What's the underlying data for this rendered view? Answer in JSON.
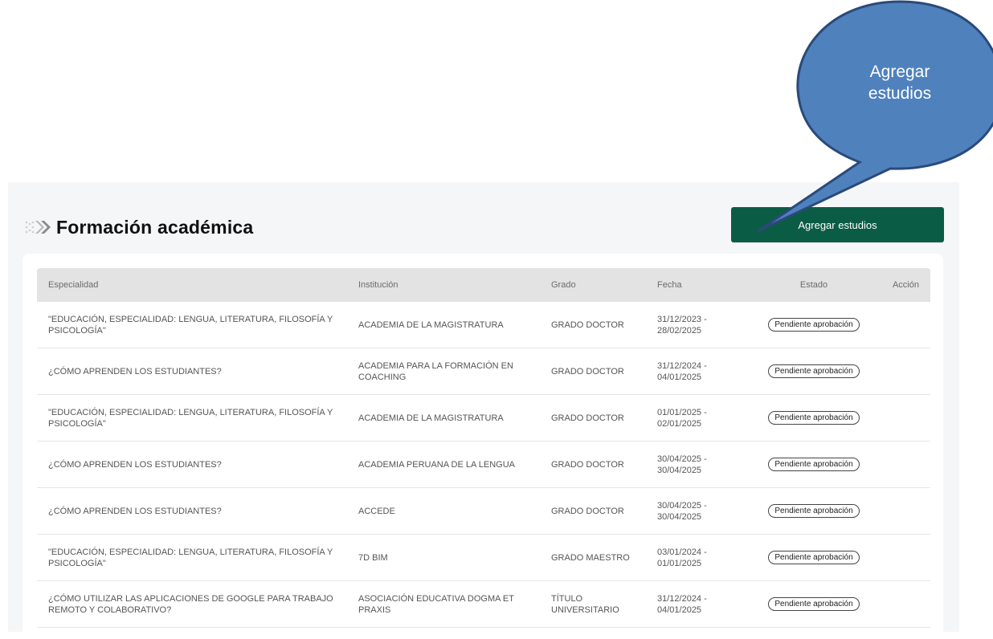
{
  "section": {
    "title": "Formación académica",
    "add_button": "Agregar estudios"
  },
  "callout": {
    "line1": "Agregar",
    "line2": "estudios"
  },
  "table": {
    "headers": [
      "Especialidad",
      "Institución",
      "Grado",
      "Fecha",
      "Estado",
      "Acción"
    ],
    "rows": [
      {
        "especialidad": "\"EDUCACIÓN, ESPECIALIDAD: LENGUA, LITERATURA, FILOSOFÍA Y PSICOLOGÍA\"",
        "institucion": "ACADEMIA DE LA MAGISTRATURA",
        "grado": "GRADO DOCTOR",
        "fecha": "31/12/2023 - 28/02/2025",
        "estado": "Pendiente aprobación"
      },
      {
        "especialidad": "¿CÓMO APRENDEN LOS ESTUDIANTES?",
        "institucion": "ACADEMIA PARA LA FORMACIÓN EN COACHING",
        "grado": "GRADO DOCTOR",
        "fecha": "31/12/2024 - 04/01/2025",
        "estado": "Pendiente aprobación"
      },
      {
        "especialidad": "\"EDUCACIÓN, ESPECIALIDAD: LENGUA, LITERATURA, FILOSOFÍA Y PSICOLOGÍA\"",
        "institucion": "ACADEMIA DE LA MAGISTRATURA",
        "grado": "GRADO DOCTOR",
        "fecha": "01/01/2025 - 02/01/2025",
        "estado": "Pendiente aprobación"
      },
      {
        "especialidad": "¿CÓMO APRENDEN LOS ESTUDIANTES?",
        "institucion": "ACADEMIA PERUANA DE LA LENGUA",
        "grado": "GRADO DOCTOR",
        "fecha": "30/04/2025 - 30/04/2025",
        "estado": "Pendiente aprobación"
      },
      {
        "especialidad": "¿CÓMO APRENDEN LOS ESTUDIANTES?",
        "institucion": "ACCEDE",
        "grado": "GRADO DOCTOR",
        "fecha": "30/04/2025 - 30/04/2025",
        "estado": "Pendiente aprobación"
      },
      {
        "especialidad": "\"EDUCACIÓN, ESPECIALIDAD: LENGUA, LITERATURA, FILOSOFÍA Y PSICOLOGÍA\"",
        "institucion": "7D BIM",
        "grado": "GRADO MAESTRO",
        "fecha": "03/01/2024 - 01/01/2025",
        "estado": "Pendiente aprobación"
      },
      {
        "especialidad": "¿CÓMO UTILIZAR LAS APLICACIONES DE GOOGLE PARA TRABAJO REMOTO Y COLABORATIVO?",
        "institucion": "ASOCIACIÓN EDUCATIVA DOGMA ET PRAXIS",
        "grado": "TÍTULO UNIVERSITARIO",
        "fecha": "31/12/2024 - 04/01/2025",
        "estado": "Pendiente aprobación"
      }
    ]
  },
  "colors": {
    "button": "#0b5c44",
    "callout_fill": "#4f81bd",
    "callout_stroke": "#2a4a7a"
  },
  "icons": {
    "title": "chevron-double-right-icon"
  }
}
